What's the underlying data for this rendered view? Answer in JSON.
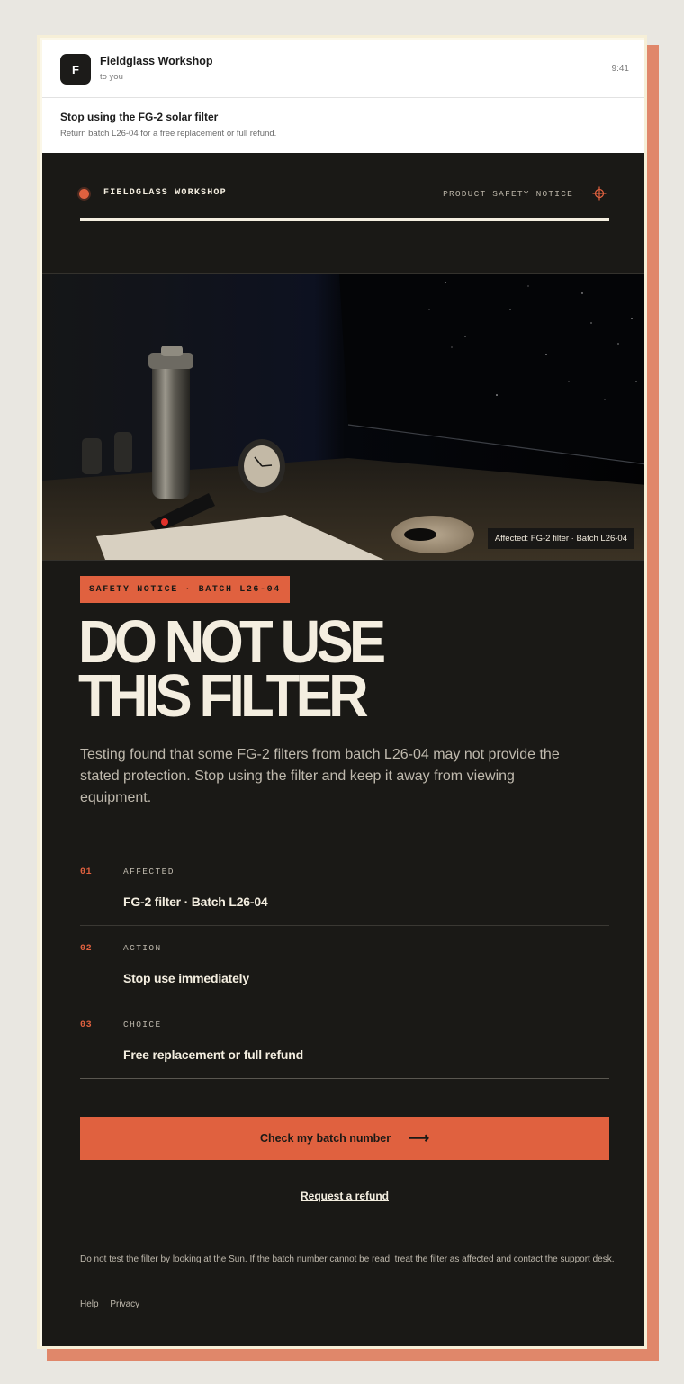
{
  "email": {
    "avatar_letter": "F",
    "sender": "Fieldglass Workshop",
    "recipient": "to you",
    "time": "9:41",
    "subject": "Stop using the FG-2 solar filter",
    "preview": "Return batch L26-04 for a free replacement or full refund."
  },
  "header": {
    "brand": "FIELDGLASS WORKSHOP",
    "notice_label": "PRODUCT SAFETY NOTICE"
  },
  "hero": {
    "caption": "Affected: FG-2 filter · Batch L26-04"
  },
  "tag": "SAFETY NOTICE · BATCH L26-04",
  "headline": [
    "DO NOT USE",
    "THIS FILTER"
  ],
  "lede": "Testing found that some FG-2 filters from batch L26-04 may not provide the stated protection. Stop using the filter and keep it away from viewing equipment.",
  "details": [
    {
      "num": "01",
      "label": "AFFECTED",
      "value": "FG-2 filter · Batch L26-04"
    },
    {
      "num": "02",
      "label": "ACTION",
      "value": "Stop use immediately"
    },
    {
      "num": "03",
      "label": "CHOICE",
      "value": "Free replacement or full refund"
    }
  ],
  "cta": {
    "label": "Check my batch number",
    "arrow": "⟶"
  },
  "secondary_link": "Request a refund",
  "footnote": "Do not test the filter by looking at the Sun. If the batch number cannot be read, treat the filter as affected and contact the support desk.",
  "footer_links": [
    "Help",
    "Privacy"
  ],
  "colors": {
    "accent": "#e0613f",
    "dark": "#1a1916",
    "cream": "#f4eee0"
  }
}
